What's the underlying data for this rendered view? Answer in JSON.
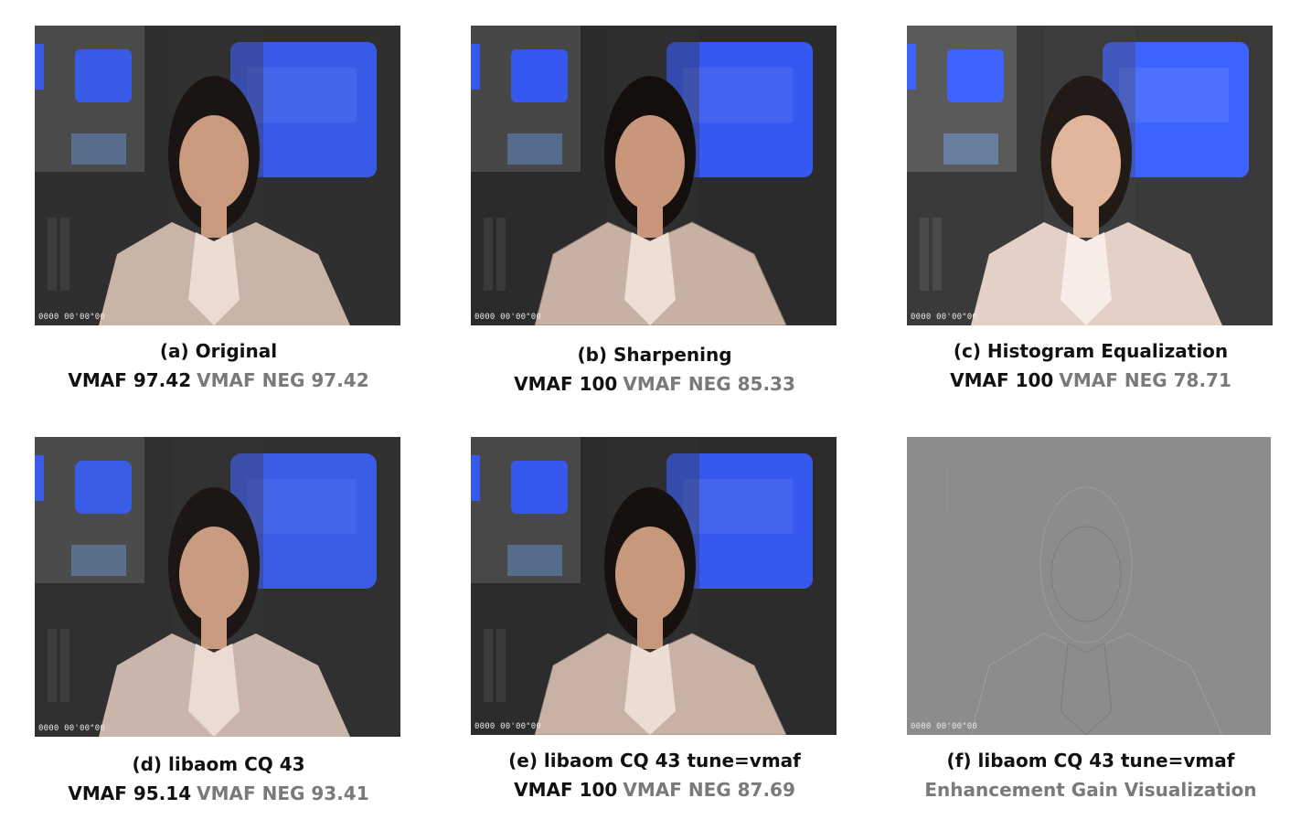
{
  "panels": [
    {
      "id": "a",
      "title": "(a) Original",
      "vmaf": "VMAF 97.42",
      "vmaf_neg": "VMAF NEG 97.42",
      "timecode": "0000 00'00\"00",
      "image": "news-anchor-original"
    },
    {
      "id": "b",
      "title": "(b) Sharpening",
      "vmaf": "VMAF 100",
      "vmaf_neg": "VMAF NEG 85.33",
      "timecode": "0000 00'00\"00",
      "image": "news-anchor-sharpened"
    },
    {
      "id": "c",
      "title": "(c) Histogram Equalization",
      "vmaf": "VMAF 100",
      "vmaf_neg": "VMAF NEG 78.71",
      "timecode": "0000 00'00\"00",
      "image": "news-anchor-histogram-equalized"
    },
    {
      "id": "d",
      "title": "(d) libaom CQ 43",
      "vmaf": "VMAF 95.14",
      "vmaf_neg": "VMAF NEG 93.41",
      "timecode": "0000 00'00\"00",
      "image": "news-anchor-libaom-cq43"
    },
    {
      "id": "e",
      "title": "(e) libaom CQ 43 tune=vmaf",
      "vmaf": "VMAF 100",
      "vmaf_neg": "VMAF NEG 87.69",
      "timecode": "0000 00'00\"00",
      "image": "news-anchor-libaom-cq43-tune-vmaf"
    },
    {
      "id": "f",
      "title": "(f) libaom CQ 43 tune=vmaf",
      "subtitle": "Enhancement Gain Visualization",
      "timecode": "0000 00'00\"00",
      "image": "enhancement-gain-gray-map"
    }
  ],
  "colors": {
    "studio_dark": "#2f2f2f",
    "monitor_blue": "#3a5be8",
    "jacket": "#c9b4a8",
    "skin": "#c99a7e",
    "hair": "#1a1412",
    "gain_gray": "#8c8c8c",
    "caption_text": "#111111",
    "caption_muted": "#7a7a7a"
  }
}
